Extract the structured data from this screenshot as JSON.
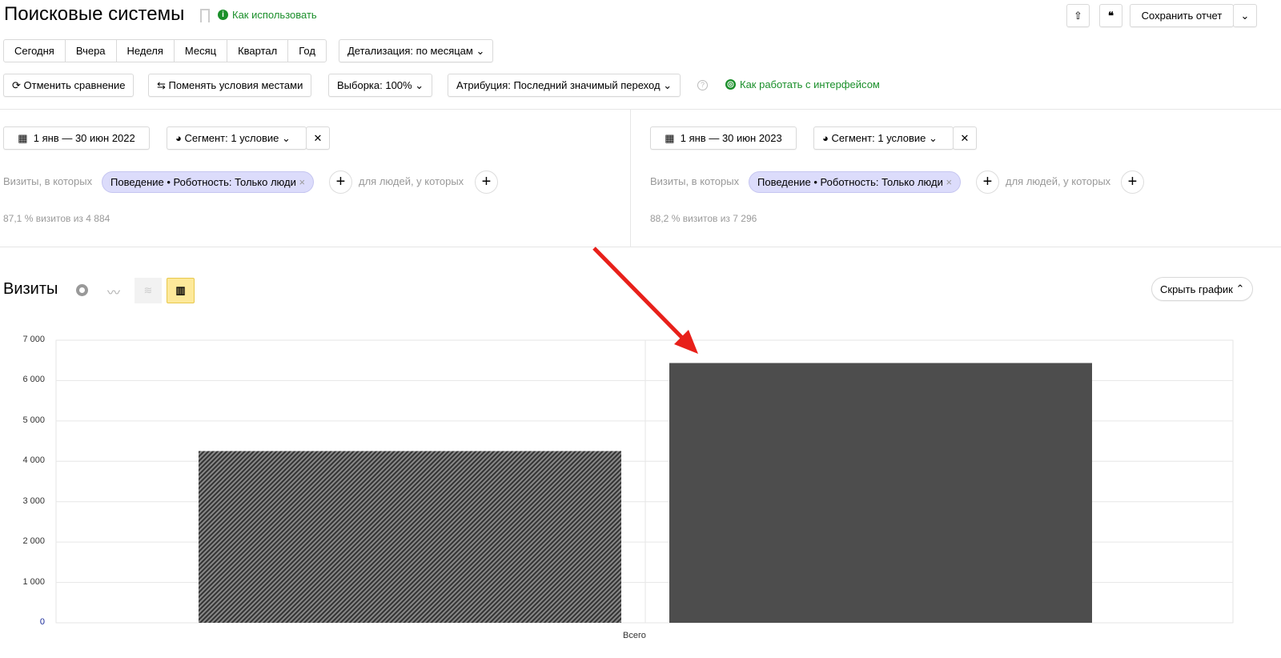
{
  "header": {
    "title": "Поисковые системы",
    "help_link": "Как использовать",
    "save_label": "Сохранить отчет"
  },
  "periods": [
    "Сегодня",
    "Вчера",
    "Неделя",
    "Месяц",
    "Квартал",
    "Год"
  ],
  "detail_label": "Детализация: по месяцам",
  "toolbar": {
    "cancel_compare": "Отменить сравнение",
    "swap": "Поменять условия местами",
    "sample": "Выборка: 100%",
    "attribution": "Атрибуция: Последний значимый переход",
    "interface_link": "Как работать с интерфейсом"
  },
  "segments": [
    {
      "date": "1 янв — 30 июн 2022",
      "segment": "Сегмент: 1 условие",
      "visits_label": "Визиты, в которых",
      "chip": "Поведение • Роботность: Только люди",
      "people_label": "для людей, у которых",
      "summary": "87,1 % визитов из 4 884"
    },
    {
      "date": "1 янв — 30 июн 2023",
      "segment": "Сегмент: 1 условие",
      "visits_label": "Визиты, в которых",
      "chip": "Поведение • Роботность: Только люди",
      "people_label": "для людей, у которых",
      "summary": "88,2 % визитов из 7 296"
    }
  ],
  "chart_header": {
    "title": "Визиты",
    "hide_label": "Скрыть график"
  },
  "chart_data": {
    "type": "bar",
    "title": "Визиты",
    "categories": [
      "Всего"
    ],
    "series": [
      {
        "name": "1 янв — 30 июн 2022",
        "values": [
          4254
        ]
      },
      {
        "name": "1 янв — 30 июн 2023",
        "values": [
          6435
        ]
      }
    ],
    "ylim": [
      0,
      7000
    ],
    "yticks": [
      "0",
      "1 000",
      "2 000",
      "3 000",
      "4 000",
      "5 000",
      "6 000",
      "7 000"
    ],
    "grid": true,
    "colors": [
      "#555555",
      "#4d4d4d"
    ]
  }
}
